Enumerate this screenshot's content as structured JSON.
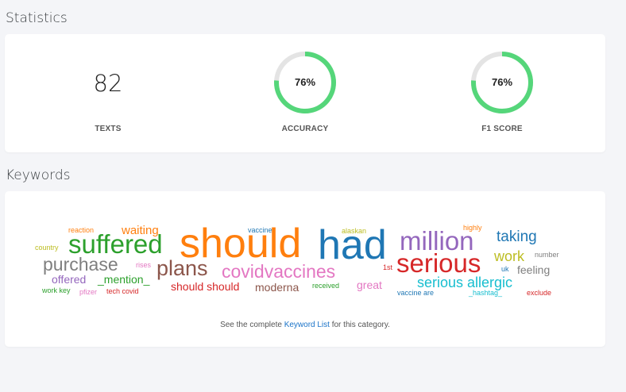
{
  "statistics": {
    "title": "Statistics",
    "texts": {
      "value": "82",
      "label": "TEXTS"
    },
    "accuracy": {
      "value": "76%",
      "fraction": 0.76,
      "label": "ACCURACY"
    },
    "f1": {
      "value": "76%",
      "fraction": 0.76,
      "label": "F1 SCORE"
    },
    "ring_color": "#55d67a",
    "ring_track_color": "#e4e4e4"
  },
  "keywords": {
    "title": "Keywords",
    "footer_prefix": "See the complete ",
    "footer_link": "Keyword List",
    "footer_suffix": " for this category.",
    "words": {
      "should": "should",
      "had": "had",
      "million": "million",
      "serious": "serious",
      "suffered": "suffered",
      "plans": "plans",
      "covidvaccines": "covidvaccines",
      "purchase": "purchase",
      "taking": "taking",
      "work": "work",
      "serious_allergic": "serious allergic",
      "waiting": "waiting",
      "mention": "_mention_",
      "offered": "offered",
      "should_should": "should should",
      "moderna": "moderna",
      "great": "great",
      "feeling": "feeling",
      "reaction": "reaction",
      "country": "country",
      "rises": "rises",
      "vaccine": "vaccine",
      "alaskan": "alaskan",
      "highly": "highly",
      "number": "number",
      "uk": "uk",
      "first": "1st",
      "received": "received",
      "work_key": "work key",
      "pfizer": "pfizer",
      "tech_covid": "tech covid",
      "vaccine_are": "vaccine are",
      "hashtag": "_hashtag_",
      "exclude": "exclude"
    }
  }
}
